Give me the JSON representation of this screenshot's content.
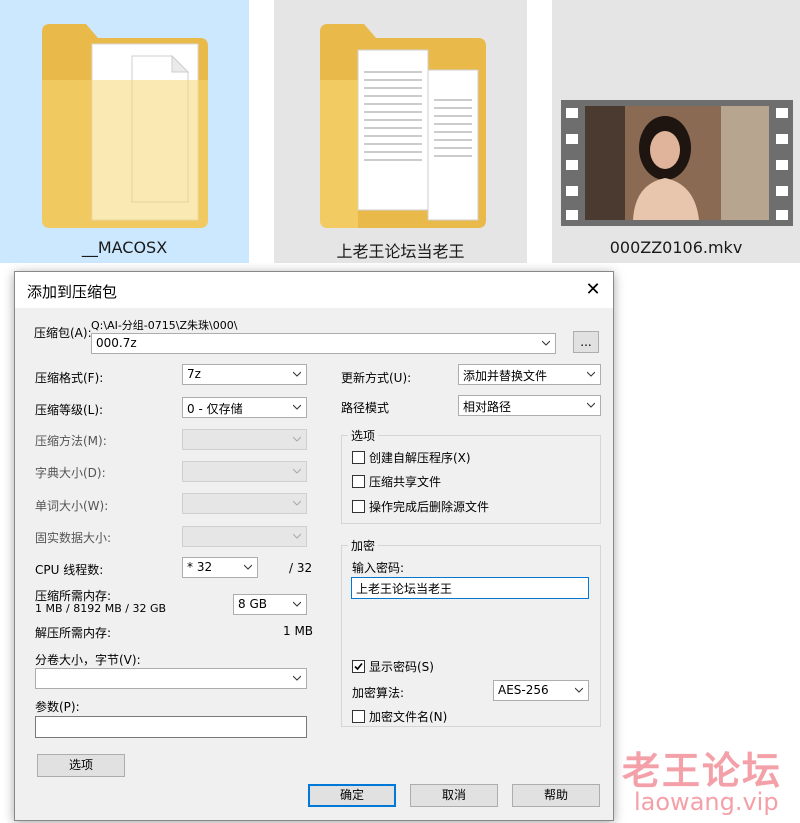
{
  "explorer": {
    "items": [
      {
        "label": "__MACOSX",
        "type": "folder"
      },
      {
        "label": "上老王论坛当老王",
        "type": "folder"
      },
      {
        "label": "000ZZ0106.mkv",
        "type": "video"
      }
    ]
  },
  "dialog": {
    "title": "添加到压缩包",
    "close_label": "✕",
    "archive": {
      "label": "压缩包(A):",
      "path": "Q:\\AI-分组-0715\\Z朱珠\\000\\",
      "value": "000.7z",
      "browse_label": "..."
    },
    "left": {
      "format": {
        "label": "压缩格式(F):",
        "value": "7z"
      },
      "level": {
        "label": "压缩等级(L):",
        "value": "0 - 仅存储"
      },
      "method": {
        "label": "压缩方法(M):"
      },
      "dict": {
        "label": "字典大小(D):"
      },
      "word": {
        "label": "单词大小(W):"
      },
      "solid": {
        "label": "固实数据大小:"
      },
      "threads": {
        "label": "CPU 线程数:",
        "value": "* 32",
        "max": "/ 32"
      },
      "mem_compress": {
        "label": "压缩所需内存:",
        "detail": "1 MB / 8192 MB / 32 GB",
        "value": "8 GB"
      },
      "mem_decompress": {
        "label": "解压所需内存:",
        "value": "1 MB"
      },
      "volume": {
        "label": "分卷大小，字节(V):",
        "value": ""
      },
      "params": {
        "label": "参数(P):",
        "value": ""
      },
      "options_button": "选项"
    },
    "right": {
      "update": {
        "label": "更新方式(U):",
        "value": "添加并替换文件"
      },
      "path_mode": {
        "label": "路径模式",
        "value": "相对路径"
      },
      "options_group": {
        "title": "选项",
        "sfx": "创建自解压程序(X)",
        "shared": "压缩共享文件",
        "delete": "操作完成后删除源文件"
      },
      "encrypt_group": {
        "title": "加密",
        "password_label": "输入密码:",
        "password_value": "上老王论坛当老王",
        "show_password": "显示密码(S)",
        "method_label": "加密算法:",
        "method_value": "AES-256",
        "encrypt_names": "加密文件名(N)"
      }
    },
    "buttons": {
      "ok": "确定",
      "cancel": "取消",
      "help": "帮助"
    }
  },
  "watermark": {
    "text": "老王论坛",
    "url": "laowang.vip"
  }
}
